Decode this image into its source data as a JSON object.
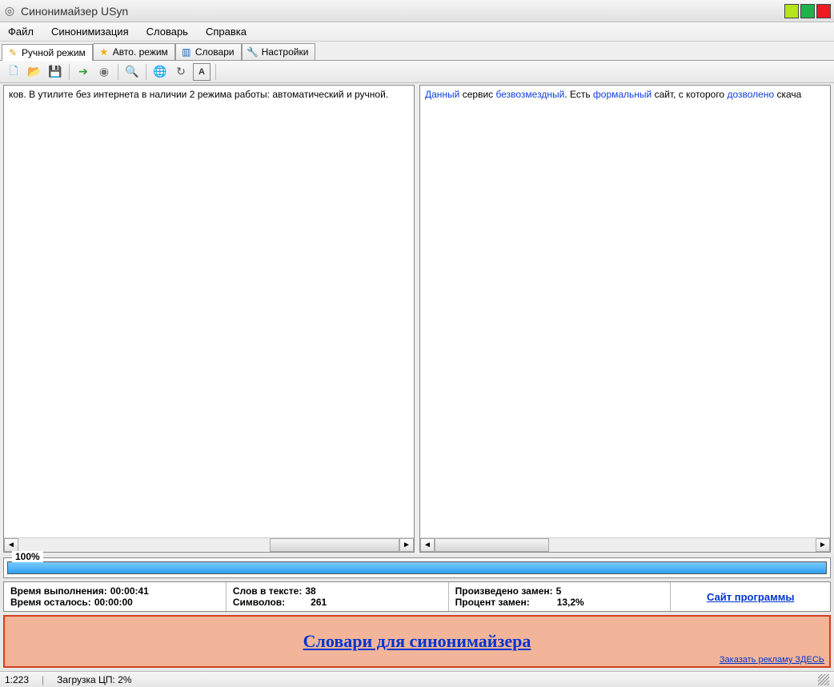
{
  "window": {
    "title": "Синонимайзер USyn"
  },
  "menu": {
    "file": "Файл",
    "syn": "Синонимизация",
    "dict": "Словарь",
    "help": "Справка"
  },
  "tabs": {
    "manual": "Ручной режим",
    "auto": "Авто. режим",
    "dicts": "Словари",
    "settings": "Настройки"
  },
  "left_text": "ков. В утилите без интернета в наличии 2 режима работы: автоматический и ручной.",
  "right_text": {
    "parts": [
      {
        "t": "Данный",
        "s": true
      },
      {
        "t": " сервис ",
        "s": false
      },
      {
        "t": "безвозмездный",
        "s": true
      },
      {
        "t": ". Есть ",
        "s": false
      },
      {
        "t": "формальный",
        "s": true
      },
      {
        "t": " сайт, с которого ",
        "s": false
      },
      {
        "t": "дозволено",
        "s": true
      },
      {
        "t": " скача",
        "s": false
      }
    ]
  },
  "progress": {
    "label": "100%"
  },
  "stats": {
    "exec_time_label": "Время выполнения:",
    "exec_time": "00:00:41",
    "remain_label": "Время осталось:",
    "remain": "00:00:00",
    "words_label": "Слов в тексте:",
    "words": "38",
    "chars_label": "Символов:",
    "chars": "261",
    "replaced_label": "Произведено замен:",
    "replaced": "5",
    "percent_label": "Процент замен:",
    "percent": "13,2%",
    "site_link": "Сайт программы"
  },
  "banner": {
    "main": "Словари для синонимайзера",
    "ad": "Заказать рекламу ЗДЕСЬ"
  },
  "status": {
    "pos": "1:223",
    "cpu": "Загрузка ЦП: 2%"
  }
}
